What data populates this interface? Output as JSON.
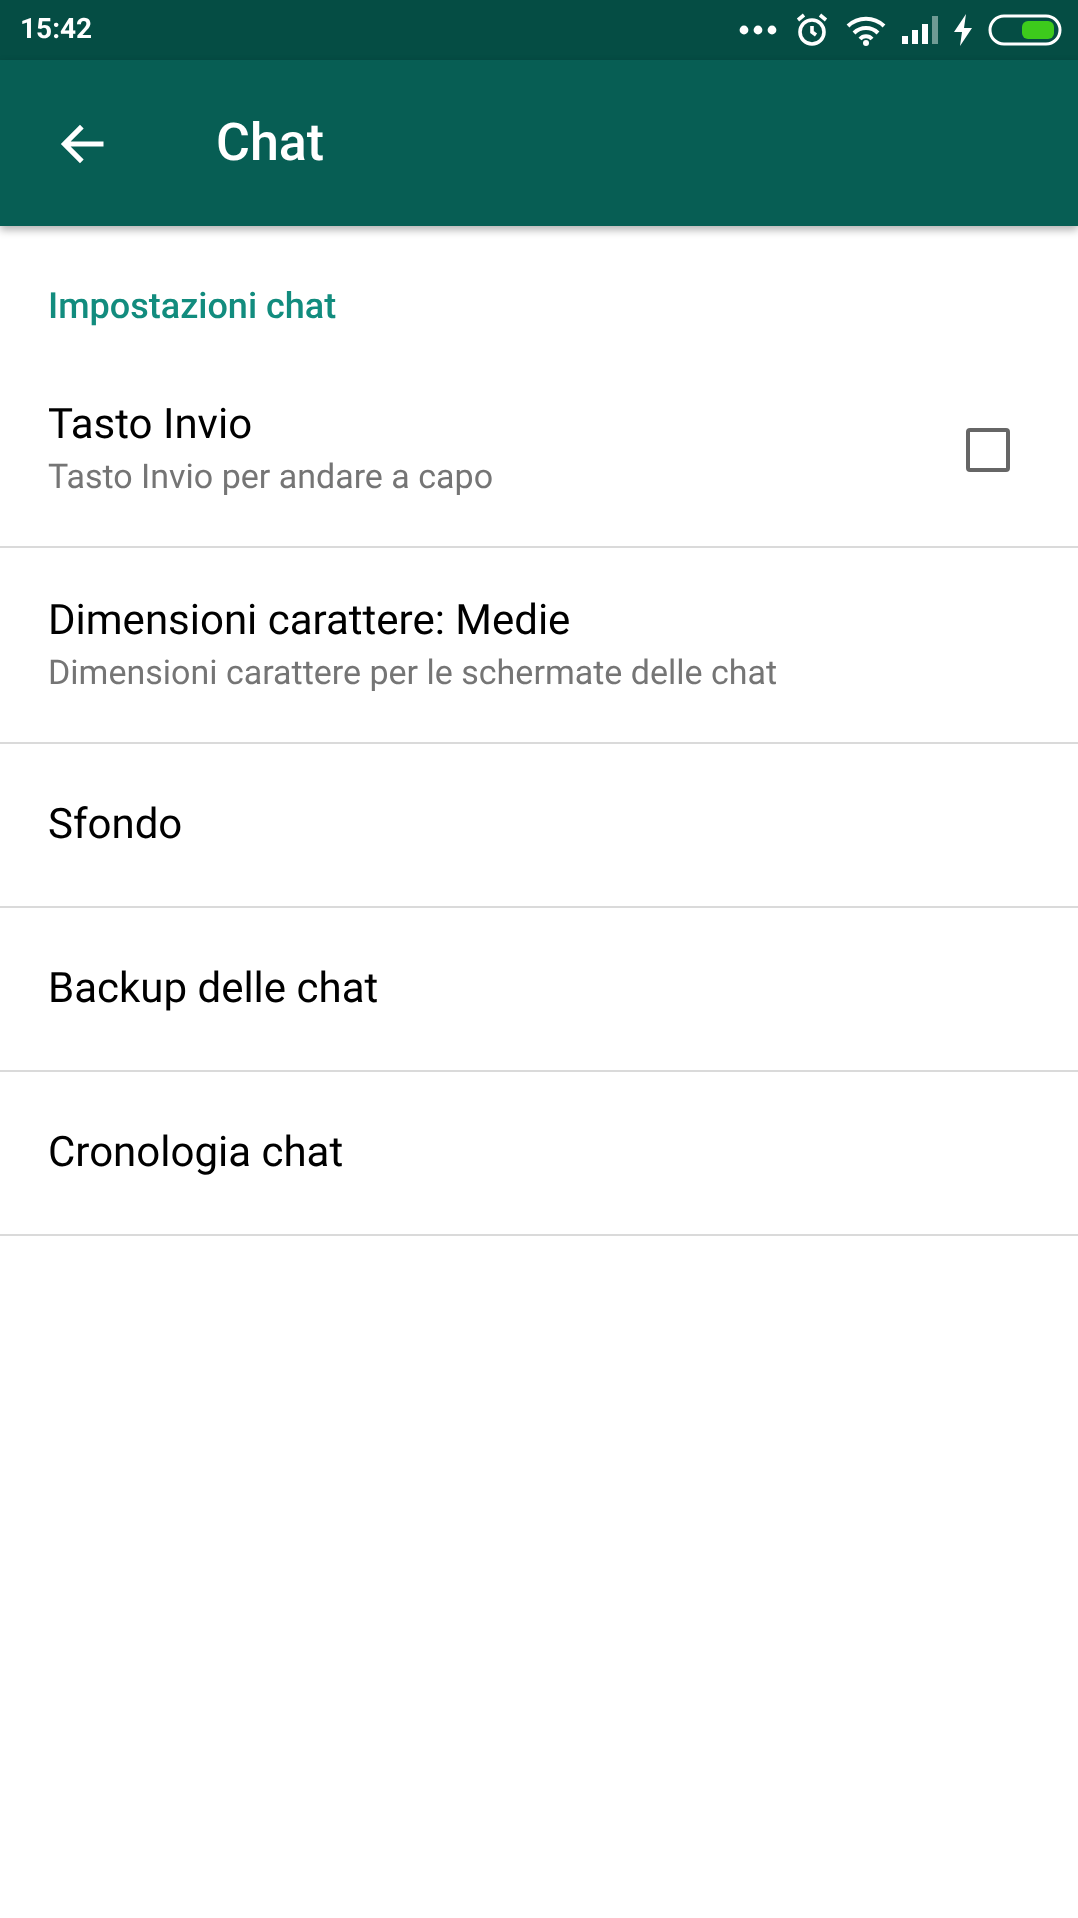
{
  "status_bar": {
    "time": "15:42"
  },
  "toolbar": {
    "title": "Chat"
  },
  "section": {
    "title": "Impostazioni chat"
  },
  "items": [
    {
      "kind": "checkbox",
      "title": "Tasto Invio",
      "subtitle": "Tasto Invio per andare a capo",
      "checked": false
    },
    {
      "kind": "text",
      "title": "Dimensioni carattere: Medie",
      "subtitle": "Dimensioni carattere per le schermate delle chat"
    },
    {
      "kind": "text",
      "title": "Sfondo"
    },
    {
      "kind": "text",
      "title": "Backup delle chat"
    },
    {
      "kind": "text",
      "title": "Cronologia chat"
    }
  ]
}
